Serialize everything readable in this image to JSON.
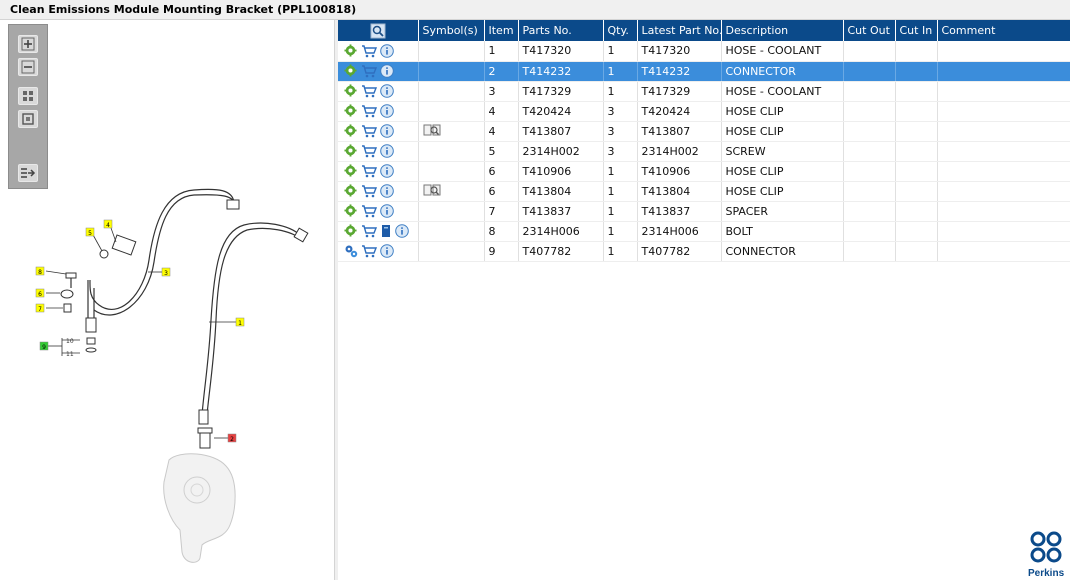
{
  "window": {
    "title": "Clean Emissions Module Mounting Bracket (PPL100818)"
  },
  "zoom_toolbar": {
    "buttons": [
      "zoom-in-icon",
      "zoom-out-icon",
      "fit-all-icon",
      "fit-window-icon",
      "export-icon"
    ]
  },
  "diagram": {
    "callouts": [
      "1",
      "2",
      "3",
      "4",
      "5",
      "6",
      "7",
      "8",
      "9",
      "10",
      "11"
    ],
    "colors": {
      "callout_yellow": "#ffff00",
      "callout_green": "#33cc33",
      "callout_red": "#e84040",
      "line": "#333333"
    }
  },
  "table": {
    "headers": [
      "",
      "Symbol(s)",
      "Item",
      "Parts No.",
      "Qty.",
      "Latest Part No.",
      "Description",
      "Cut Out",
      "Cut In",
      "Comment"
    ],
    "rows": [
      {
        "item": "1",
        "part_no": "T417320",
        "qty": "1",
        "latest_part_no": "T417320",
        "description": "HOSE - COOLANT",
        "cut_out": "",
        "cut_in": "",
        "comment": "",
        "symbol": "",
        "row_icon": "gear-icon",
        "selected": false
      },
      {
        "item": "2",
        "part_no": "T414232",
        "qty": "1",
        "latest_part_no": "T414232",
        "description": "CONNECTOR",
        "cut_out": "",
        "cut_in": "",
        "comment": "",
        "symbol": "",
        "row_icon": "gear-icon",
        "selected": true
      },
      {
        "item": "3",
        "part_no": "T417329",
        "qty": "1",
        "latest_part_no": "T417329",
        "description": "HOSE - COOLANT",
        "cut_out": "",
        "cut_in": "",
        "comment": "",
        "symbol": "",
        "row_icon": "gear-icon",
        "selected": false
      },
      {
        "item": "4",
        "part_no": "T420424",
        "qty": "3",
        "latest_part_no": "T420424",
        "description": "HOSE CLIP",
        "cut_out": "",
        "cut_in": "",
        "comment": "",
        "symbol": "",
        "row_icon": "gear-icon",
        "selected": false
      },
      {
        "item": "4",
        "part_no": "T413807",
        "qty": "3",
        "latest_part_no": "T413807",
        "description": "HOSE CLIP",
        "cut_out": "",
        "cut_in": "",
        "comment": "",
        "symbol": "book-icon",
        "row_icon": "gear-icon",
        "selected": false
      },
      {
        "item": "5",
        "part_no": "2314H002",
        "qty": "3",
        "latest_part_no": "2314H002",
        "description": "SCREW",
        "cut_out": "",
        "cut_in": "",
        "comment": "",
        "symbol": "",
        "row_icon": "gear-icon",
        "selected": false
      },
      {
        "item": "6",
        "part_no": "T410906",
        "qty": "1",
        "latest_part_no": "T410906",
        "description": "HOSE CLIP",
        "cut_out": "",
        "cut_in": "",
        "comment": "",
        "symbol": "",
        "row_icon": "gear-icon",
        "selected": false
      },
      {
        "item": "6",
        "part_no": "T413804",
        "qty": "1",
        "latest_part_no": "T413804",
        "description": "HOSE CLIP",
        "cut_out": "",
        "cut_in": "",
        "comment": "",
        "symbol": "book-icon",
        "row_icon": "gear-icon",
        "selected": false
      },
      {
        "item": "7",
        "part_no": "T413837",
        "qty": "1",
        "latest_part_no": "T413837",
        "description": "SPACER",
        "cut_out": "",
        "cut_in": "",
        "comment": "",
        "symbol": "",
        "row_icon": "gear-icon",
        "selected": false
      },
      {
        "item": "8",
        "part_no": "2314H006",
        "qty": "1",
        "latest_part_no": "2314H006",
        "description": "BOLT",
        "cut_out": "",
        "cut_in": "",
        "comment": "",
        "symbol": "",
        "row_icon": "gear-icon",
        "extra_icon": "document-icon",
        "selected": false
      },
      {
        "item": "9",
        "part_no": "T407782",
        "qty": "1",
        "latest_part_no": "T407782",
        "description": "CONNECTOR",
        "cut_out": "",
        "cut_in": "",
        "comment": "",
        "symbol": "",
        "row_icon": "gears-icon",
        "selected": false
      }
    ]
  },
  "colors": {
    "header_bg": "#0b4a8a",
    "selected_row": "#3b8ddb",
    "brand": "#0b4a8a"
  },
  "logo": {
    "text": "Perkins"
  }
}
